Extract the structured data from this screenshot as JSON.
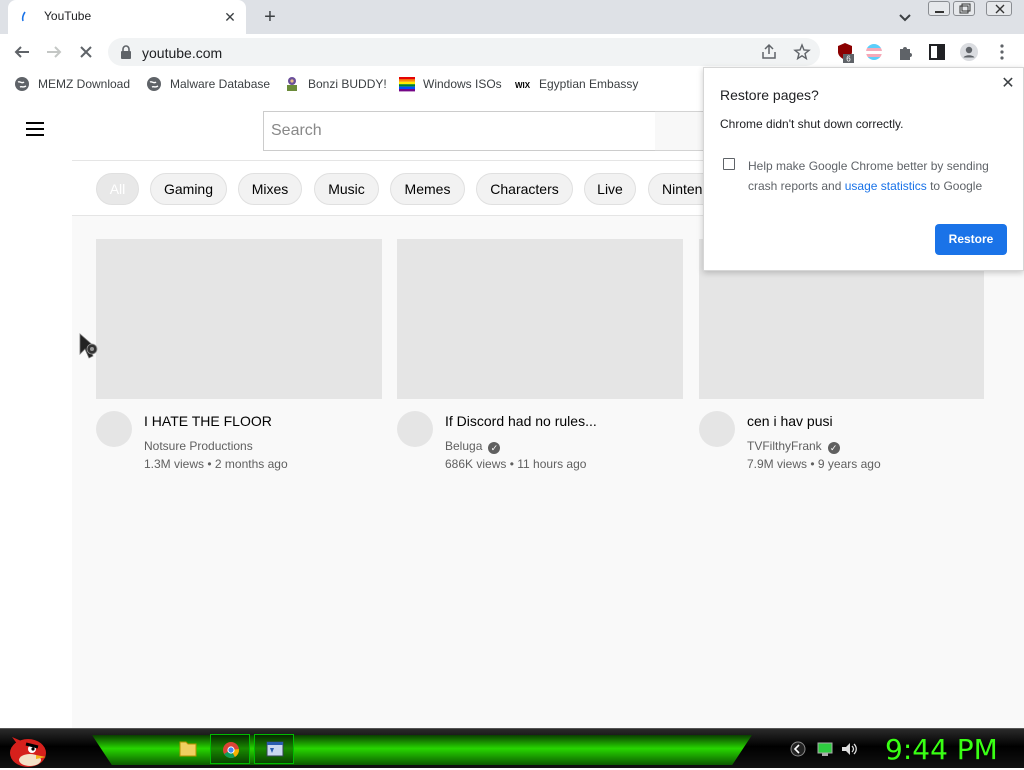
{
  "tab": {
    "title": "YouTube",
    "close_label": "✕",
    "newtab_label": "+"
  },
  "toolbar": {
    "url": "youtube.com",
    "extension_badge": "6"
  },
  "bookmarks": [
    {
      "label": "MEMZ Download",
      "icon": "globe-icon"
    },
    {
      "label": "Malware Database",
      "icon": "globe-icon"
    },
    {
      "label": "Bonzi BUDDY!",
      "icon": "bonzi-icon"
    },
    {
      "label": "Windows ISOs",
      "icon": "windows-flag-icon"
    },
    {
      "label": "Egyptian Embassy",
      "icon": "wix-icon"
    }
  ],
  "youtube": {
    "search_placeholder": "Search",
    "chips": [
      "All",
      "Gaming",
      "Mixes",
      "Music",
      "Memes",
      "Characters",
      "Live",
      "Ninten"
    ],
    "videos": [
      {
        "title": "I HATE THE FLOOR",
        "channel": "Notsure Productions",
        "verified": false,
        "views": "1.3M views",
        "age": "2 months ago"
      },
      {
        "title": "If Discord had no rules...",
        "channel": "Beluga",
        "verified": true,
        "views": "686K views",
        "age": "11 hours ago"
      },
      {
        "title": "cen i hav pusi",
        "channel": "TVFilthyFrank",
        "verified": true,
        "views": "7.9M views",
        "age": "9 years ago"
      }
    ],
    "meta_separator": "•"
  },
  "restore_popup": {
    "title": "Restore pages?",
    "subtitle": "Chrome didn't shut down correctly.",
    "checkbox_text_before": "Help make Google Chrome better by sending crash reports and ",
    "checkbox_link": "usage statistics",
    "checkbox_text_after": " to Google",
    "restore_button": "Restore",
    "close_label": "✕"
  },
  "taskbar": {
    "clock": "9:44 PM"
  },
  "colors": {
    "accent": "#1a73e8",
    "clock": "#39ff14",
    "taskbar_glow": "#27d600"
  }
}
